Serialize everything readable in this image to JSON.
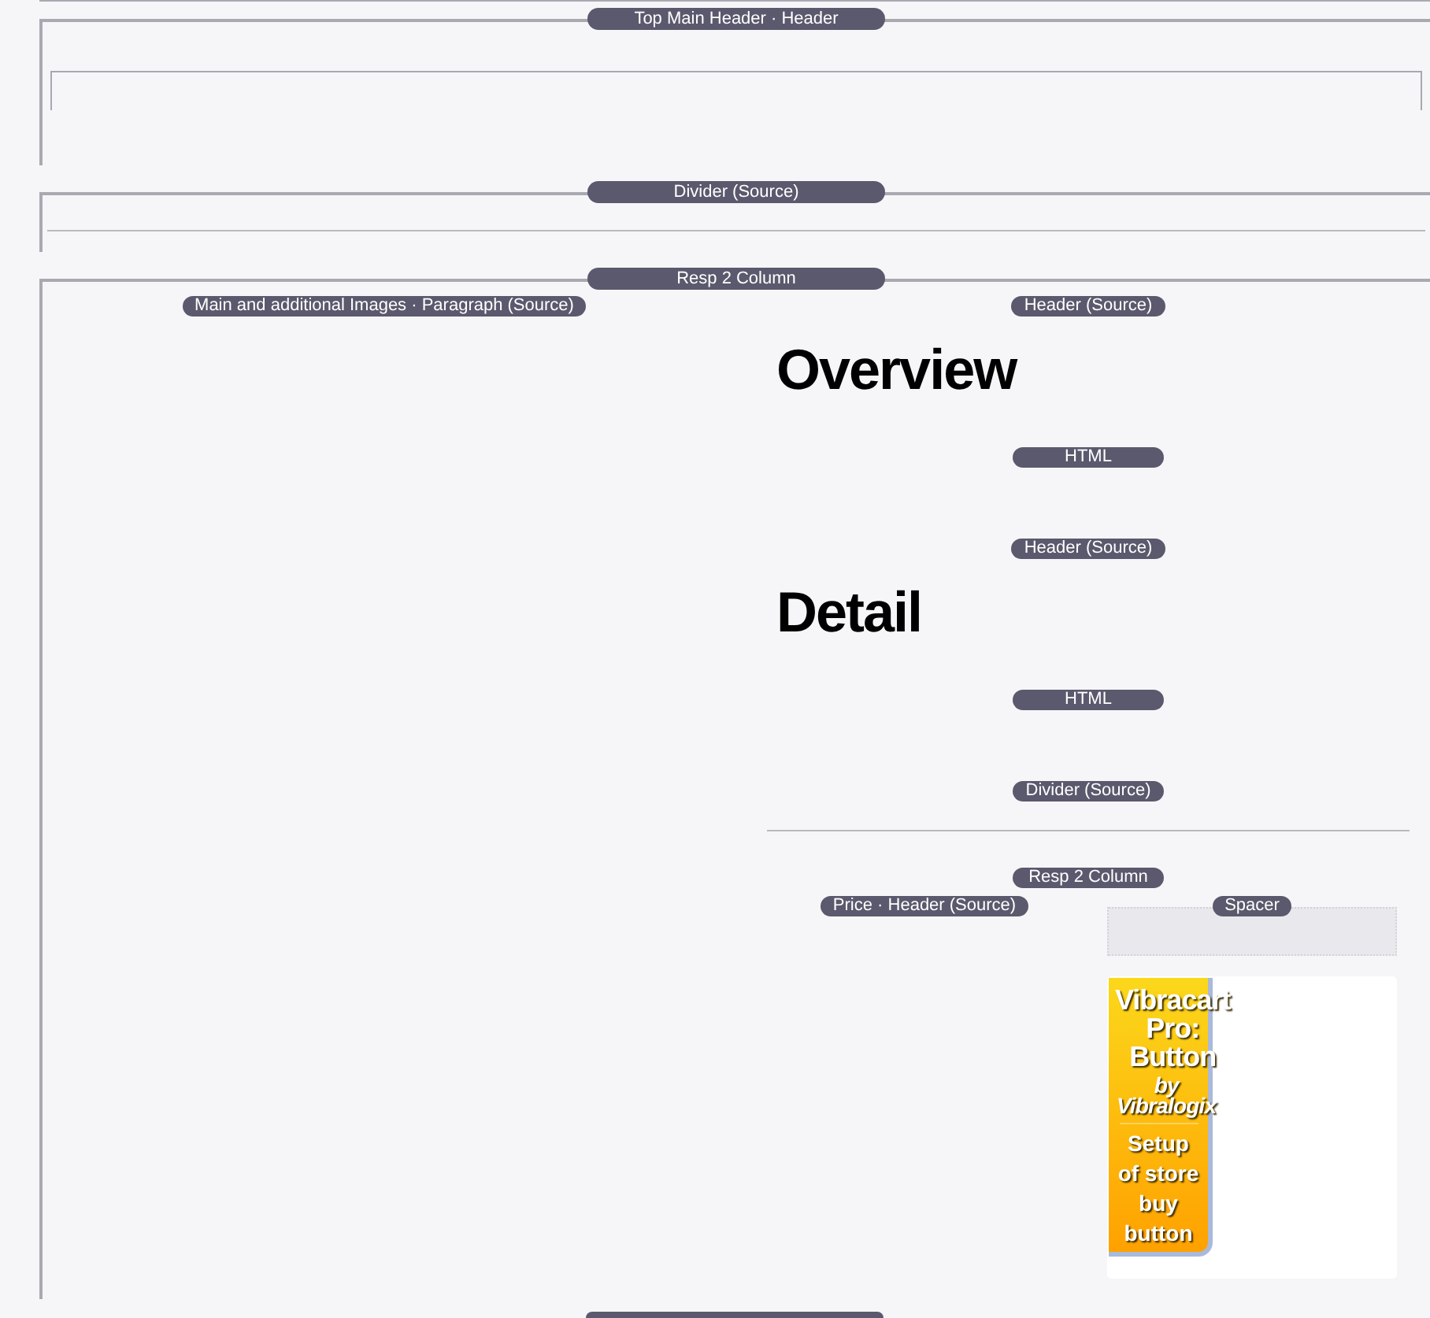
{
  "sections": [
    {
      "kind": "header_block",
      "label": "Top Main Header · Header"
    },
    {
      "kind": "divider",
      "label": "Divider (Source)"
    },
    {
      "kind": "columns",
      "label": "Resp 2 Column",
      "columns": [
        {
          "blocks": [
            {
              "kind": "label_only",
              "label": "Main and additional Images · Paragraph (Source)"
            }
          ]
        },
        {
          "blocks": [
            {
              "kind": "heading",
              "label": "Header (Source)",
              "text": "Overview"
            },
            {
              "kind": "html",
              "label": "HTML"
            },
            {
              "kind": "heading",
              "label": "Header (Source)",
              "text": "Detail"
            },
            {
              "kind": "html",
              "label": "HTML"
            },
            {
              "kind": "divider",
              "label": "Divider (Source)"
            },
            {
              "kind": "columns",
              "label": "Resp 2 Column",
              "columns": [
                {
                  "blocks": [
                    {
                      "kind": "label_only",
                      "label": "Price · Header (Source)"
                    }
                  ]
                },
                {
                  "blocks": [
                    {
                      "kind": "spacer",
                      "label": "Spacer"
                    },
                    {
                      "kind": "image_button",
                      "title": "Vibracart Pro: Button",
                      "byline": "by Vibralogix",
                      "caption": "Setup of store buy button"
                    }
                  ]
                }
              ]
            }
          ]
        }
      ]
    }
  ]
}
